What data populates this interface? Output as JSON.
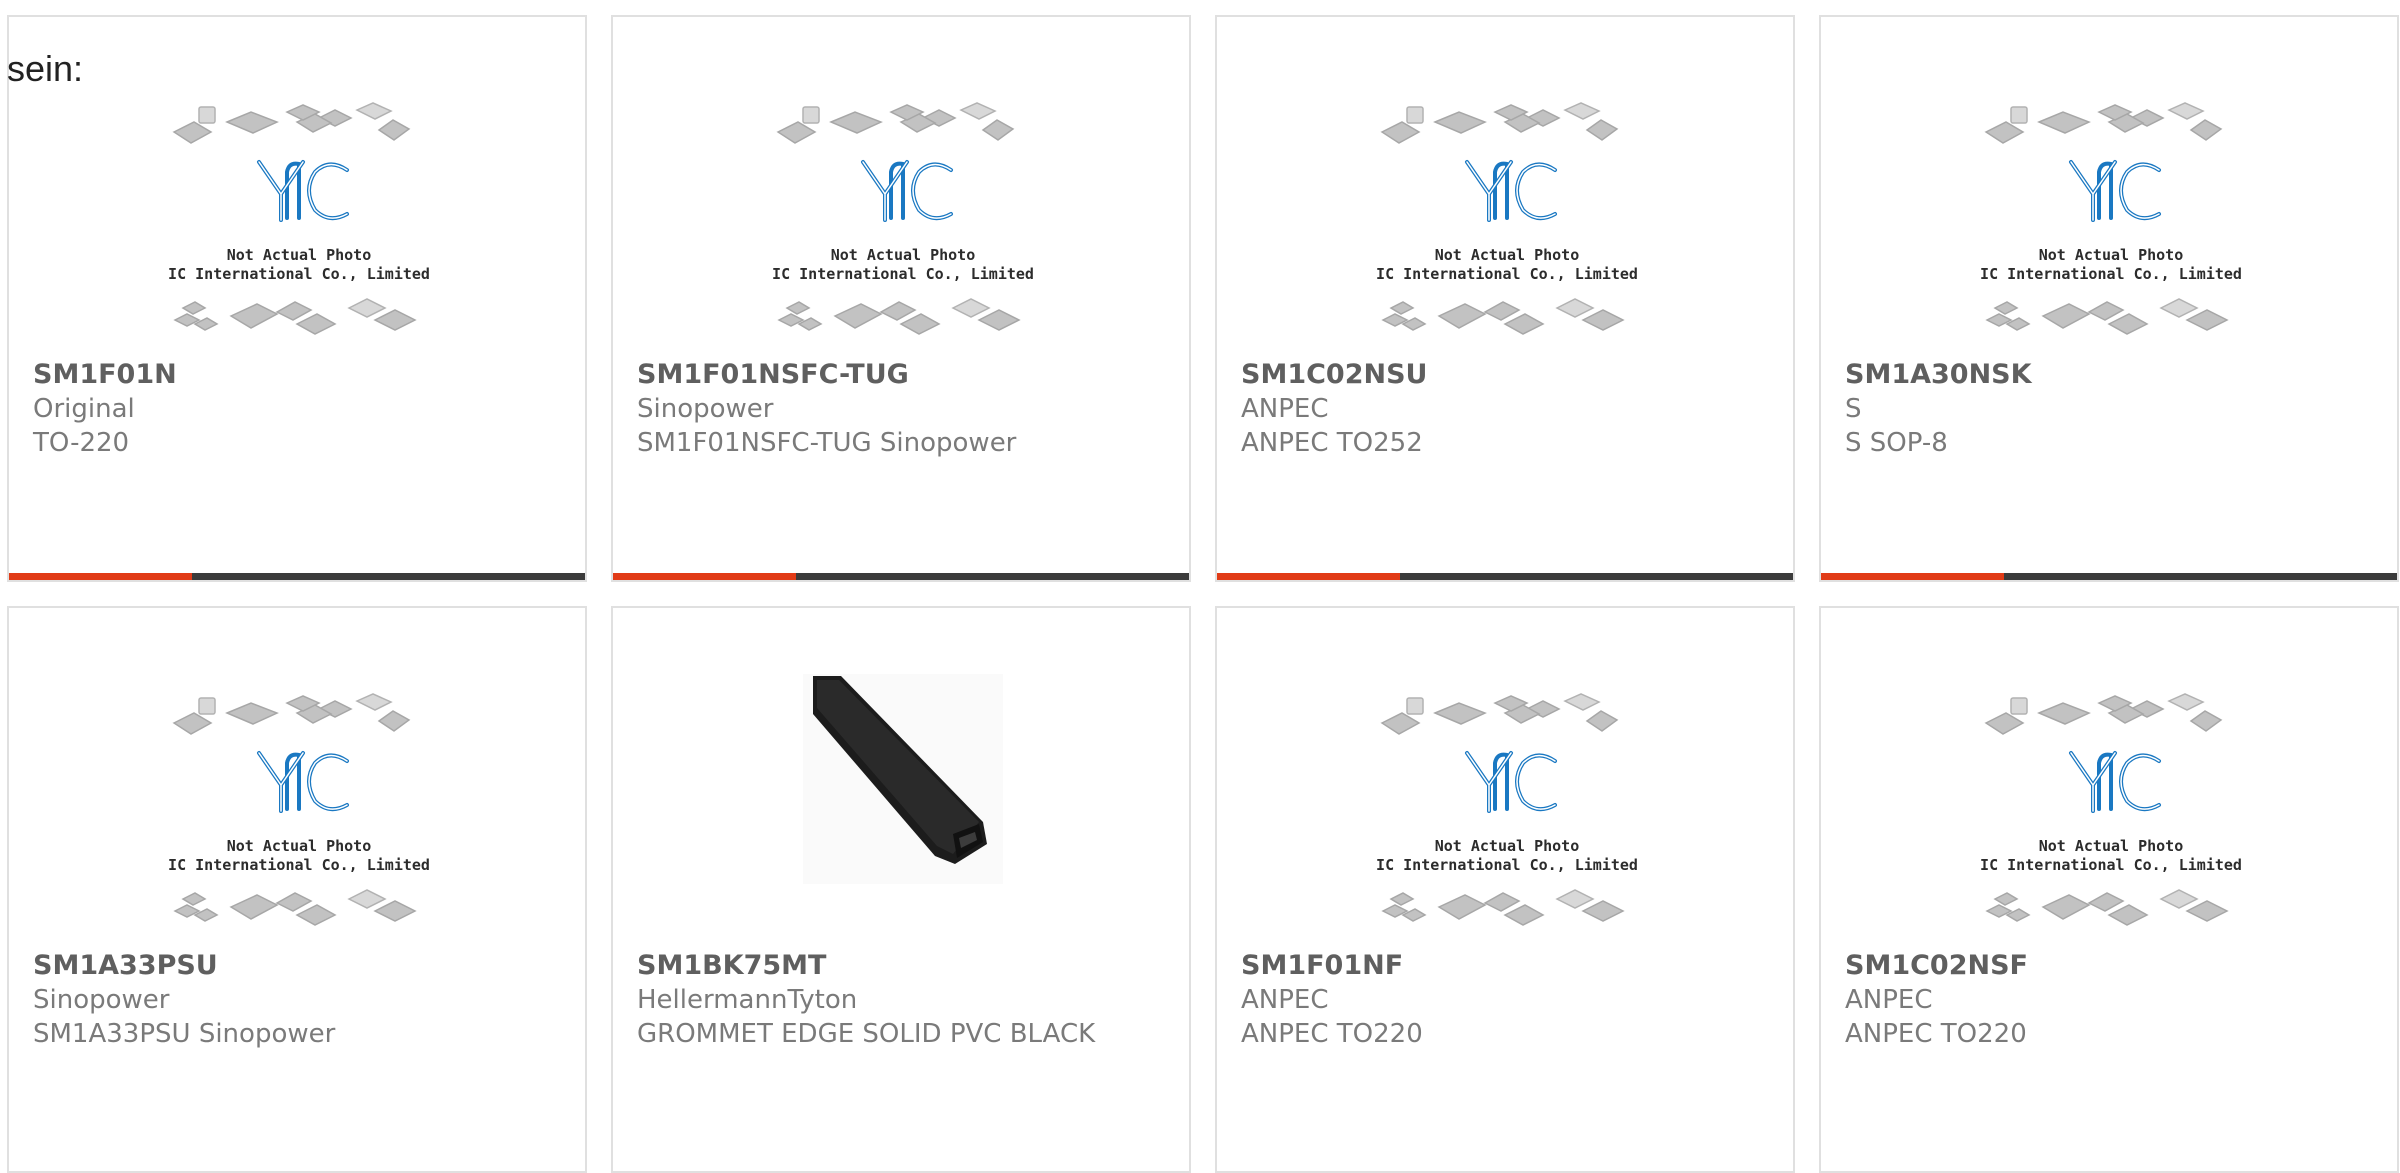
{
  "page": {
    "text_fragment": "sein:",
    "colors": {
      "accent": "#e13b17",
      "bar": "#3b3b3b",
      "border": "#e0e0e0",
      "logo": "#1a78c2"
    }
  },
  "placeholder_photo": {
    "logo_text": "YIC",
    "caption_line1": "Not Actual Photo",
    "caption_line2": "YIC International Co., Limited."
  },
  "products": [
    {
      "part_number": "SM1F01N",
      "manufacturer": "Original",
      "description": "TO-220",
      "image": "placeholder-photo"
    },
    {
      "part_number": "SM1F01NSFC-TUG",
      "manufacturer": "Sinopower",
      "description": "SM1F01NSFC-TUG Sinopower",
      "image": "placeholder-photo"
    },
    {
      "part_number": "SM1C02NSU",
      "manufacturer": "ANPEC",
      "description": "ANPEC TO252",
      "image": "placeholder-photo"
    },
    {
      "part_number": "SM1A30NSK",
      "manufacturer": "S",
      "description": "S SOP-8",
      "image": "placeholder-photo"
    },
    {
      "part_number": "SM1A33PSU",
      "manufacturer": "Sinopower",
      "description": "SM1A33PSU Sinopower",
      "image": "placeholder-photo"
    },
    {
      "part_number": "SM1BK75MT",
      "manufacturer": "HellermannTyton",
      "description": "GROMMET EDGE SOLID PVC BLACK",
      "image": "grommet-photo"
    },
    {
      "part_number": "SM1F01NF",
      "manufacturer": "ANPEC",
      "description": "ANPEC TO220",
      "image": "placeholder-photo"
    },
    {
      "part_number": "SM1C02NSF",
      "manufacturer": "ANPEC",
      "description": "ANPEC TO220",
      "image": "placeholder-photo"
    }
  ]
}
